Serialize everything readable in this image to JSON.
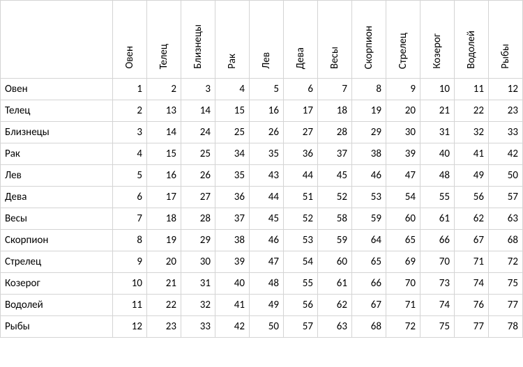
{
  "chart_data": {
    "type": "table",
    "title": "",
    "row_labels": [
      "Овен",
      "Телец",
      "Близнецы",
      "Рак",
      "Лев",
      "Дева",
      "Весы",
      "Скорпион",
      "Стрелец",
      "Козерог",
      "Водолей",
      "Рыбы"
    ],
    "col_labels": [
      "Овен",
      "Телец",
      "Близнецы",
      "Рак",
      "Лев",
      "Дева",
      "Весы",
      "Скорпион",
      "Стрелец",
      "Козерог",
      "Водолей",
      "Рыбы"
    ],
    "values": [
      [
        1,
        2,
        3,
        4,
        5,
        6,
        7,
        8,
        9,
        10,
        11,
        12
      ],
      [
        2,
        13,
        14,
        15,
        16,
        17,
        18,
        19,
        20,
        21,
        22,
        23
      ],
      [
        3,
        14,
        24,
        25,
        26,
        27,
        28,
        29,
        30,
        31,
        32,
        33
      ],
      [
        4,
        15,
        25,
        34,
        35,
        36,
        37,
        38,
        39,
        40,
        41,
        42
      ],
      [
        5,
        16,
        26,
        35,
        43,
        44,
        45,
        46,
        47,
        48,
        49,
        50
      ],
      [
        6,
        17,
        27,
        36,
        44,
        51,
        52,
        53,
        54,
        55,
        56,
        57
      ],
      [
        7,
        18,
        28,
        37,
        45,
        52,
        58,
        59,
        60,
        61,
        62,
        63
      ],
      [
        8,
        19,
        29,
        38,
        46,
        53,
        59,
        64,
        65,
        66,
        67,
        68
      ],
      [
        9,
        20,
        30,
        39,
        47,
        54,
        60,
        65,
        69,
        70,
        71,
        72
      ],
      [
        10,
        21,
        31,
        40,
        48,
        55,
        61,
        66,
        70,
        73,
        74,
        75
      ],
      [
        11,
        22,
        32,
        41,
        49,
        56,
        62,
        67,
        71,
        74,
        76,
        77
      ],
      [
        12,
        23,
        33,
        42,
        50,
        57,
        63,
        68,
        72,
        75,
        77,
        78
      ]
    ]
  }
}
